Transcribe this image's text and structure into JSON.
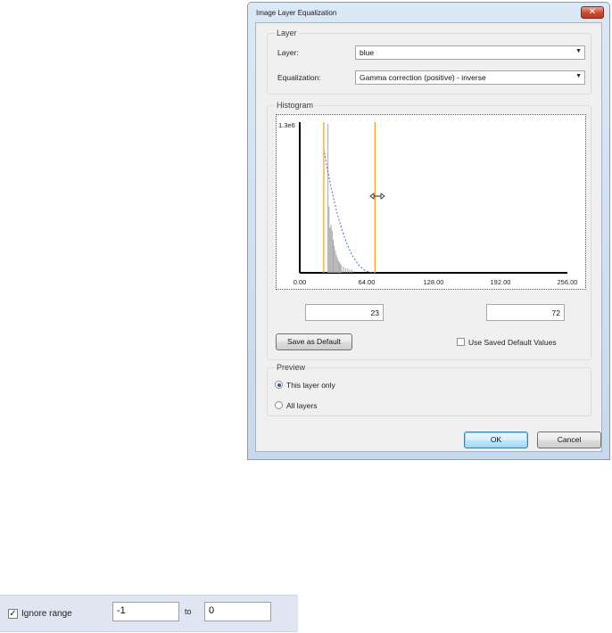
{
  "dialog": {
    "title": "Image Layer Equalization",
    "close_icon": "close-icon"
  },
  "layer_group": {
    "label": "Layer",
    "layer_label": "Layer:",
    "layer_value": "blue",
    "equalization_label": "Equalization:",
    "equalization_value": "Gamma correction (positive) - inverse"
  },
  "histogram": {
    "label": "Histogram",
    "y_max_label": "1.3e6",
    "x_ticks": [
      "0.00",
      "64.00",
      "128.00",
      "192.00",
      "256.00"
    ],
    "low_value": "23",
    "high_value": "72",
    "cursor_icon": "resize-horizontal-icon",
    "save_default_label": "Save as Default",
    "use_saved_label": "Use Saved Default Values",
    "use_saved_checked": false
  },
  "chart_data": {
    "type": "bar",
    "xlim": [
      0,
      256
    ],
    "x_ticks": [
      0,
      64,
      128,
      192,
      256
    ],
    "y_max_label": "1.3e6",
    "range_markers": [
      23,
      72
    ],
    "bars": [
      {
        "x": 27,
        "v": 0.99
      },
      {
        "x": 28,
        "v": 0.44
      },
      {
        "x": 29,
        "v": 0.3
      },
      {
        "x": 30,
        "v": 0.32
      },
      {
        "x": 31,
        "v": 0.28
      },
      {
        "x": 32,
        "v": 0.22
      },
      {
        "x": 33,
        "v": 0.18
      },
      {
        "x": 34,
        "v": 0.15
      },
      {
        "x": 35,
        "v": 0.12
      },
      {
        "x": 36,
        "v": 0.1
      },
      {
        "x": 37,
        "v": 0.08
      },
      {
        "x": 38,
        "v": 0.07
      },
      {
        "x": 39,
        "v": 0.06
      },
      {
        "x": 40,
        "v": 0.05
      },
      {
        "x": 42,
        "v": 0.04
      },
      {
        "x": 44,
        "v": 0.03
      },
      {
        "x": 46,
        "v": 0.03
      },
      {
        "x": 48,
        "v": 0.02
      },
      {
        "x": 50,
        "v": 0.02
      }
    ],
    "curve_style": "dashed blue",
    "marker_color": "#f0a020",
    "bar_color": "#a8a8a8",
    "curve_color": "#4a68d8"
  },
  "preview_group": {
    "label": "Preview",
    "option_this": "This layer only",
    "option_all": "All layers",
    "selected": "This layer only"
  },
  "buttons": {
    "ok": "OK",
    "cancel": "Cancel"
  },
  "range_filter": {
    "checkbox_label": "Ignore range",
    "checked": true,
    "from_value": "-1",
    "to_label": "to",
    "to_value": "0"
  }
}
